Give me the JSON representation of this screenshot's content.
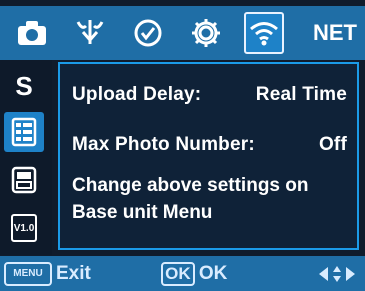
{
  "top_tabs": {
    "items": [
      {
        "icon": "camera-icon"
      },
      {
        "icon": "antenna-icon"
      },
      {
        "icon": "clock-check-icon"
      },
      {
        "icon": "gear-icon"
      },
      {
        "icon": "wifi-icon"
      }
    ],
    "net_label": "NET",
    "active_index": 4
  },
  "sidebar": {
    "items": [
      {
        "label": "S",
        "icon": "s-letter-icon"
      },
      {
        "icon": "list-icon"
      },
      {
        "icon": "printer-icon"
      },
      {
        "label": "V1.0",
        "icon": "version-icon"
      }
    ],
    "active_index": 1
  },
  "panel": {
    "upload_delay_label": "Upload Delay:",
    "upload_delay_value": "Real Time",
    "max_photo_label": "Max Photo Number:",
    "max_photo_value": "Off",
    "note_line1": "Change above settings on",
    "note_line2": "Base unit Menu"
  },
  "footer": {
    "menu_key": "MENU",
    "exit_label": "Exit",
    "ok_key": "OK",
    "ok_label": "OK"
  },
  "colors": {
    "bar": "#1f6ea6",
    "accent": "#1b9be8",
    "text": "#ffffff"
  }
}
